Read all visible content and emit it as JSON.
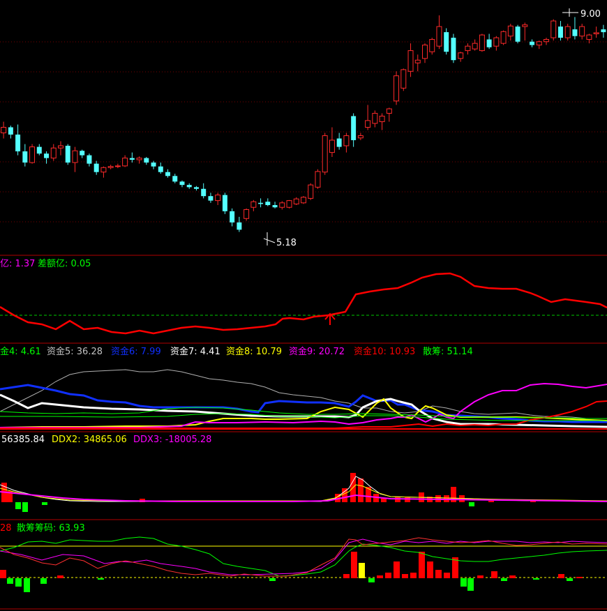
{
  "colors": {
    "background": "#000000",
    "panel_border": "#b00000",
    "grid": "#7a0000",
    "candle_up": "#ff2a2a",
    "candle_down": "#54ffff",
    "white": "#ffffff",
    "yellow": "#ffff00",
    "green": "#00ff00",
    "magenta": "#ff00ff",
    "blue": "#1030ff",
    "gray": "#c0c0c0",
    "red": "#ff0000"
  },
  "annotations": {
    "high_label": "9.00",
    "low_label": "5.18"
  },
  "panel2": {
    "legend": [
      {
        "text": "亿: 1.37",
        "color": "#ff00ff"
      },
      {
        "text": "差额亿: 0.05",
        "color": "#00ff00"
      }
    ]
  },
  "panel3": {
    "legend": [
      {
        "text": "金4: 4.61",
        "color": "#00ff00"
      },
      {
        "text": "资金5: 36.28",
        "color": "#c0c0c0"
      },
      {
        "text": "资金6: 7.99",
        "color": "#1030ff"
      },
      {
        "text": "资金7: 4.41",
        "color": "#ffffff"
      },
      {
        "text": "资金8: 10.79",
        "color": "#ffff00"
      },
      {
        "text": "资金9: 20.72",
        "color": "#ff00ff"
      },
      {
        "text": "资金10: 10.93",
        "color": "#ff0000"
      },
      {
        "text": "散筹: 51.14",
        "color": "#00ff00"
      }
    ]
  },
  "panel4": {
    "legend": [
      {
        "text": "56385.84",
        "color": "#ffffff"
      },
      {
        "text": "DDX2: 34865.06",
        "color": "#ffff00"
      },
      {
        "text": "DDX3: -18005.28",
        "color": "#ff00ff"
      }
    ]
  },
  "panel5": {
    "legend": [
      {
        "text": "28",
        "color": "#ff0000"
      },
      {
        "text": "散筹筹码: 63.93",
        "color": "#00ff00"
      }
    ]
  },
  "chart_data": {
    "type": "candlestick",
    "ylim": [
      4.9,
      9.2
    ],
    "candles": [
      [
        6.95,
        7.15,
        6.85,
        7.05
      ],
      [
        7.05,
        7.08,
        6.85,
        6.92
      ],
      [
        6.92,
        7.1,
        6.55,
        6.62
      ],
      [
        6.62,
        6.75,
        6.35,
        6.42
      ],
      [
        6.42,
        6.75,
        6.4,
        6.7
      ],
      [
        6.7,
        6.75,
        6.55,
        6.58
      ],
      [
        6.58,
        6.62,
        6.4,
        6.5
      ],
      [
        6.5,
        6.75,
        6.45,
        6.68
      ],
      [
        6.68,
        6.8,
        6.55,
        6.72
      ],
      [
        6.72,
        6.75,
        6.38,
        6.42
      ],
      [
        6.42,
        6.7,
        6.25,
        6.63
      ],
      [
        6.63,
        6.65,
        6.5,
        6.55
      ],
      [
        6.55,
        6.58,
        6.35,
        6.4
      ],
      [
        6.4,
        6.45,
        6.2,
        6.25
      ],
      [
        6.25,
        6.35,
        6.15,
        6.33
      ],
      [
        6.33,
        6.38,
        6.3,
        6.35
      ],
      [
        6.35,
        6.4,
        6.32,
        6.36
      ],
      [
        6.36,
        6.55,
        6.34,
        6.5
      ],
      [
        6.5,
        6.6,
        6.42,
        6.47
      ],
      [
        6.47,
        6.53,
        6.4,
        6.5
      ],
      [
        6.5,
        6.52,
        6.38,
        6.42
      ],
      [
        6.42,
        6.45,
        6.3,
        6.35
      ],
      [
        6.35,
        6.42,
        6.22,
        6.25
      ],
      [
        6.25,
        6.3,
        6.15,
        6.18
      ],
      [
        6.18,
        6.22,
        6.05,
        6.08
      ],
      [
        6.08,
        6.1,
        5.98,
        6.02
      ],
      [
        6.02,
        6.05,
        5.95,
        5.98
      ],
      [
        5.98,
        6.0,
        5.92,
        5.95
      ],
      [
        5.95,
        6.05,
        5.78,
        5.82
      ],
      [
        5.82,
        5.88,
        5.7,
        5.74
      ],
      [
        5.74,
        5.88,
        5.66,
        5.84
      ],
      [
        5.84,
        5.88,
        5.5,
        5.55
      ],
      [
        5.55,
        5.6,
        5.28,
        5.35
      ],
      [
        5.35,
        5.45,
        5.18,
        5.22
      ],
      [
        5.42,
        5.6,
        5.38,
        5.58
      ],
      [
        5.62,
        5.75,
        5.55,
        5.72
      ],
      [
        5.7,
        5.78,
        5.62,
        5.68
      ],
      [
        5.72,
        5.78,
        5.64,
        5.66
      ],
      [
        5.66,
        5.72,
        5.6,
        5.62
      ],
      [
        5.62,
        5.73,
        5.58,
        5.7
      ],
      [
        5.62,
        5.75,
        5.6,
        5.74
      ],
      [
        5.68,
        5.8,
        5.66,
        5.77
      ],
      [
        5.7,
        5.82,
        5.68,
        5.8
      ],
      [
        5.78,
        6.05,
        5.75,
        6.02
      ],
      [
        5.98,
        6.3,
        5.95,
        6.26
      ],
      [
        6.25,
        6.95,
        6.2,
        6.9
      ],
      [
        6.6,
        7.05,
        6.52,
        6.82
      ],
      [
        6.85,
        6.95,
        6.65,
        6.7
      ],
      [
        6.72,
        6.95,
        6.6,
        6.9
      ],
      [
        7.25,
        7.3,
        6.7,
        6.82
      ],
      [
        6.86,
        6.95,
        6.82,
        6.9
      ],
      [
        7.05,
        7.45,
        7.0,
        7.17
      ],
      [
        7.12,
        7.35,
        7.05,
        7.3
      ],
      [
        7.15,
        7.3,
        7.0,
        7.25
      ],
      [
        7.3,
        7.4,
        7.15,
        7.38
      ],
      [
        7.52,
        8.05,
        7.45,
        7.97
      ],
      [
        7.75,
        8.1,
        7.7,
        8.08
      ],
      [
        8.05,
        8.55,
        7.95,
        8.42
      ],
      [
        8.2,
        8.35,
        8.05,
        8.25
      ],
      [
        8.28,
        8.55,
        8.2,
        8.52
      ],
      [
        8.4,
        8.65,
        8.35,
        8.62
      ],
      [
        8.5,
        9.05,
        8.45,
        8.85
      ],
      [
        8.75,
        8.82,
        8.35,
        8.4
      ],
      [
        8.65,
        8.72,
        8.2,
        8.25
      ],
      [
        8.28,
        8.4,
        8.22,
        8.38
      ],
      [
        8.42,
        8.55,
        8.35,
        8.5
      ],
      [
        8.45,
        8.62,
        8.42,
        8.55
      ],
      [
        8.42,
        8.72,
        8.4,
        8.7
      ],
      [
        8.62,
        8.72,
        8.45,
        8.48
      ],
      [
        8.5,
        8.68,
        8.42,
        8.65
      ],
      [
        8.55,
        8.78,
        8.52,
        8.76
      ],
      [
        8.68,
        8.9,
        8.6,
        8.86
      ],
      [
        8.85,
        8.88,
        8.55,
        8.58
      ],
      [
        8.85,
        8.92,
        8.6,
        8.88
      ],
      [
        8.58,
        8.62,
        8.48,
        8.52
      ],
      [
        8.52,
        8.6,
        8.45,
        8.58
      ],
      [
        8.58,
        8.65,
        8.52,
        8.62
      ],
      [
        8.65,
        8.98,
        8.6,
        8.95
      ],
      [
        8.85,
        8.95,
        8.6,
        8.65
      ],
      [
        8.65,
        8.9,
        8.6,
        8.85
      ],
      [
        8.8,
        9.02,
        8.62,
        8.68
      ],
      [
        8.68,
        8.9,
        8.62,
        8.85
      ],
      [
        8.62,
        8.72,
        8.55,
        8.7
      ],
      [
        8.72,
        8.85,
        8.65,
        8.74
      ],
      [
        8.8,
        8.88,
        8.65,
        8.75
      ]
    ]
  }
}
